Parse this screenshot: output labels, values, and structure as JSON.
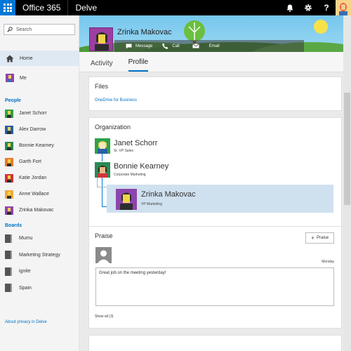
{
  "topbar": {
    "suite_title": "Office 365",
    "app_title": "Delve",
    "icons": [
      "bell-icon",
      "gear-icon",
      "help-icon",
      "user-avatar"
    ],
    "help_label": "?"
  },
  "sidebar": {
    "search_placeholder": "Search",
    "home_label": "Home",
    "me_label": "Me",
    "people_header": "People",
    "people": [
      {
        "name": "Janet Schorr",
        "color": "#2da24a"
      },
      {
        "name": "Alex Darrow",
        "color": "#2a5fa5"
      },
      {
        "name": "Bonnie Kearney",
        "color": "#2a8a55"
      },
      {
        "name": "Garth Fort",
        "color": "#e8792a"
      },
      {
        "name": "Katie Jordan",
        "color": "#d13438"
      },
      {
        "name": "Anne Wallace",
        "color": "#f0a93a"
      },
      {
        "name": "Zrinka Makovac",
        "color": "#8e44ad"
      }
    ],
    "boards_header": "Boards",
    "boards": [
      "Mumu",
      "Marketing Strategy",
      "ignite",
      "Spain"
    ],
    "privacy_link": "About privacy in Delve"
  },
  "profile": {
    "name": "Zrinka Makovac",
    "actions": {
      "message": "Message",
      "call": "Call",
      "email": "Email"
    },
    "tabs": [
      "Activity",
      "Profile"
    ],
    "active_tab": "Profile"
  },
  "files": {
    "title": "Files",
    "link": "OneDrive for Business"
  },
  "organization": {
    "title": "Organization",
    "people": [
      {
        "name": "Janet Schorr",
        "role": "Sr. VP Sales",
        "color": "#2da24a"
      },
      {
        "name": "Bonnie Kearney",
        "role": "Corporate Marketing",
        "color": "#2a8a55"
      },
      {
        "name": "Zrinka Makovac",
        "role": "VP Marketing",
        "color": "#8e44ad"
      }
    ]
  },
  "praise": {
    "title": "Praise",
    "button_label": "Praise",
    "date": "Monday",
    "message": "Great job on the meeting yesterday!",
    "show_all": "Show all (3)"
  },
  "colors": {
    "accent": "#0072c6",
    "topbar": "#000000",
    "waffle": "#0078d7",
    "selected_row": "#cfe0ef"
  }
}
